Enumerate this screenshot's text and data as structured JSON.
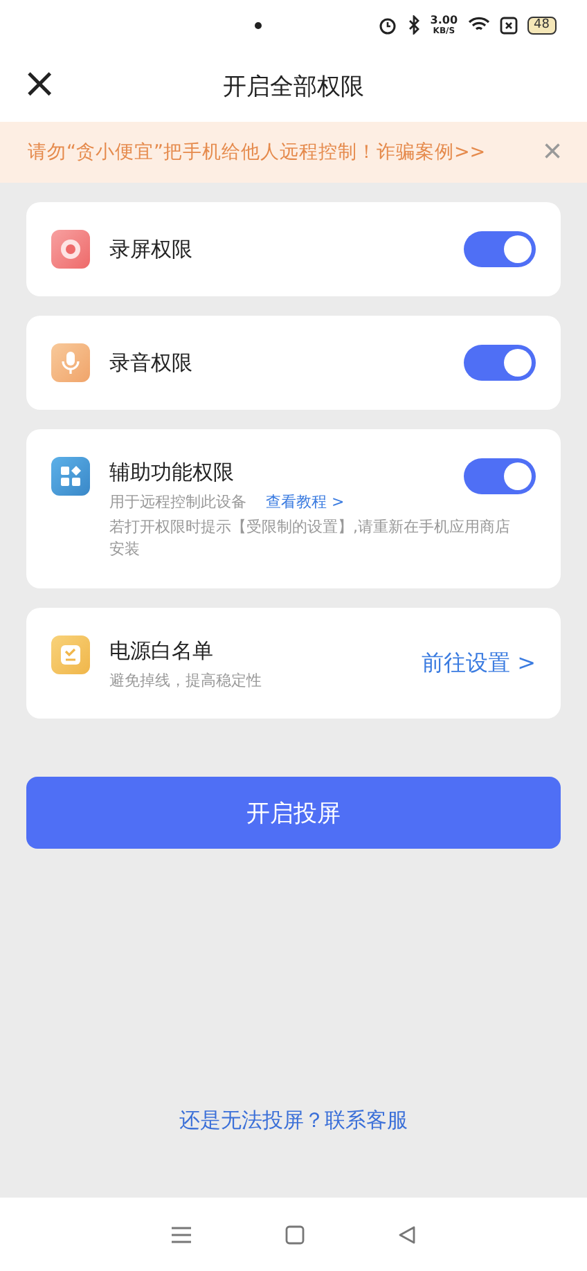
{
  "status_bar": {
    "speed_value": "3.00",
    "speed_unit": "KB/S",
    "battery": "48"
  },
  "header": {
    "title": "开启全部权限",
    "close": "×"
  },
  "banner": {
    "text": "请勿“贪小便宜”把手机给他人远程控制！诈骗案例>>",
    "close": "×"
  },
  "permissions": [
    {
      "kind": "toggle",
      "title": "录屏权限",
      "on": true
    },
    {
      "kind": "toggle",
      "title": "录音权限",
      "on": true
    },
    {
      "kind": "toggle",
      "title": "辅助功能权限",
      "on": true,
      "subtitle": "用于远程控制此设备",
      "link": "查看教程 >",
      "note": "若打开权限时提示【受限制的设置】,请重新在手机应用商店安装"
    },
    {
      "kind": "action",
      "title": "电源白名单",
      "subtitle": "避免掉线，提高稳定性",
      "action": "前往设置 >"
    }
  ],
  "primary_button": "开启投屏",
  "help_link": "还是无法投屏？联系客服"
}
